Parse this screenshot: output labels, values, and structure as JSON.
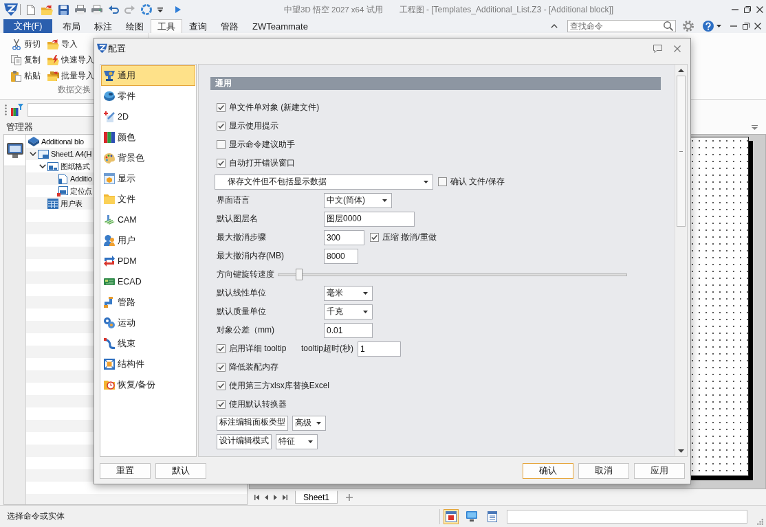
{
  "title_bar": {
    "app_title": "中望3D 悟空 2027 x64 试用",
    "document_title": "工程图 - [Templates_Additional_List.Z3 - [Additional block]]",
    "quick_access": [
      {
        "disabled": false
      },
      {
        "disabled": false
      },
      {
        "disabled": false
      },
      {
        "disabled": false
      },
      {
        "disabled": false
      },
      {
        "disabled": false
      },
      {
        "disabled": true
      },
      {
        "disabled": false
      }
    ]
  },
  "ribbon_tabs": {
    "file_button": "文件(F)",
    "tabs": [
      {
        "label": "布局",
        "selected": false
      },
      {
        "label": "标注",
        "selected": false
      },
      {
        "label": "绘图",
        "selected": false
      },
      {
        "label": "工具",
        "selected": true
      },
      {
        "label": "查询",
        "selected": false
      },
      {
        "label": "管路",
        "selected": false
      },
      {
        "label": "ZWTeammate",
        "selected": false
      }
    ],
    "search": {
      "placeholder": "查找命令"
    }
  },
  "ribbon": {
    "groups": [
      {
        "label": "数据交换",
        "items": [
          {
            "label": "剪切"
          },
          {
            "label": "复制"
          },
          {
            "label": "粘贴"
          },
          {
            "label": "导入"
          },
          {
            "label": "快速导入"
          },
          {
            "label": "批量导入"
          }
        ]
      }
    ]
  },
  "manager": {
    "title": "管理器",
    "tree": [
      {
        "kind": "block",
        "label": "Additional blo",
        "children": [
          {
            "kind": "sheet",
            "label": "Sheet1 A4(H",
            "expanded": true,
            "children": [
              {
                "kind": "format",
                "label": "图纸格式",
                "expanded": true,
                "children": [
                  {
                    "kind": "page",
                    "label": "Additio"
                  },
                  {
                    "kind": "point",
                    "label": "定位点"
                  }
                ]
              },
              {
                "kind": "table",
                "label": "用户表"
              }
            ]
          }
        ]
      }
    ]
  },
  "sheet_tabs": [
    {
      "label": "Sheet1",
      "selected": true
    }
  ],
  "status_bar": {
    "prompt": "选择命令或实体",
    "view_buttons": [
      {
        "selected": true
      },
      {
        "selected": false
      },
      {
        "selected": false
      }
    ]
  },
  "dialog": {
    "title": "配置",
    "categories": [
      {
        "label": "通用",
        "selected": true
      },
      {
        "label": "零件",
        "selected": false
      },
      {
        "label": "2D",
        "selected": false
      },
      {
        "label": "颜色",
        "selected": false
      },
      {
        "label": "背景色",
        "selected": false
      },
      {
        "label": "显示",
        "selected": false
      },
      {
        "label": "文件",
        "selected": false
      },
      {
        "label": "CAM",
        "selected": false
      },
      {
        "label": "用户",
        "selected": false
      },
      {
        "label": "PDM",
        "selected": false
      },
      {
        "label": "ECAD",
        "selected": false
      },
      {
        "label": "管路",
        "selected": false
      },
      {
        "label": "运动",
        "selected": false
      },
      {
        "label": "线束",
        "selected": false
      },
      {
        "label": "结构件",
        "selected": false
      },
      {
        "label": "恢复/备份",
        "selected": false
      }
    ],
    "section_title": "通用",
    "settings": [
      {
        "kind": "checkbox",
        "label": "单文件单对象 (新建文件)",
        "checked": true
      },
      {
        "kind": "checkbox",
        "label": "显示使用提示",
        "checked": true
      },
      {
        "kind": "checkbox",
        "label": "显示命令建议助手",
        "checked": false
      },
      {
        "kind": "checkbox",
        "label": "自动打开错误窗口",
        "checked": true
      },
      {
        "kind": "wide_dropdown",
        "value": "保存文件但不包括显示数据",
        "check_label": "确认 文件/保存",
        "checked": false
      },
      {
        "kind": "dropdown",
        "label": "界面语言",
        "value": "中文(简体)"
      },
      {
        "kind": "input",
        "label": "默认图层名",
        "value": "图层0000"
      },
      {
        "kind": "input",
        "label": "最大撤消步骤",
        "value": "300",
        "check_label": "压缩 撤消/重做",
        "checked": true
      },
      {
        "kind": "input",
        "label": "最大撤消内存(MB)",
        "value": "8000"
      },
      {
        "kind": "slider",
        "label": "方向键旋转速度",
        "level": 0.05
      },
      {
        "kind": "dropdown",
        "label": "默认线性单位",
        "value": "毫米"
      },
      {
        "kind": "dropdown",
        "label": "默认质量单位",
        "value": "千克"
      },
      {
        "kind": "input",
        "label": "对象公差（mm)",
        "value": "0.01"
      },
      {
        "kind": "checkbox",
        "label": "启用详细 tooltip",
        "checked": true,
        "field_label": "tooltip超时(秒)",
        "value": "1"
      },
      {
        "kind": "checkbox",
        "label": "降低装配内存",
        "checked": true
      },
      {
        "kind": "checkbox",
        "label": "使用第三方xlsx库替换Excel",
        "checked": true
      },
      {
        "kind": "checkbox",
        "label": "使用默认转换器",
        "checked": true
      },
      {
        "kind": "inline_dropdown",
        "label": "标注编辑面板类型",
        "value": "高级"
      },
      {
        "kind": "inline_dropdown",
        "label": "设计编辑模式",
        "value": "特征"
      }
    ],
    "left_buttons": [
      {
        "label": "重置",
        "default": false
      },
      {
        "label": "默认",
        "default": false
      }
    ],
    "right_buttons": [
      {
        "label": "确认",
        "default": true
      },
      {
        "label": "取消",
        "default": false
      },
      {
        "label": "应用",
        "default": false
      }
    ]
  }
}
